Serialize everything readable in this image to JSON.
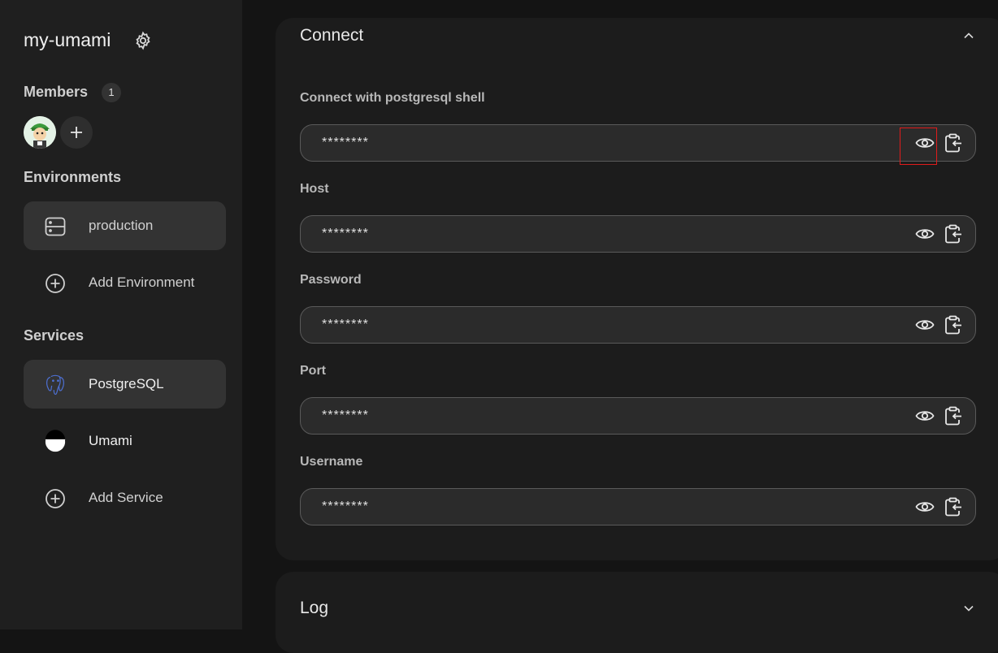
{
  "project": {
    "name": "my-umami"
  },
  "members": {
    "heading": "Members",
    "count": "1"
  },
  "environments": {
    "heading": "Environments",
    "items": [
      {
        "label": "production",
        "icon": "server-icon"
      }
    ],
    "add_label": "Add Environment"
  },
  "services": {
    "heading": "Services",
    "items": [
      {
        "label": "PostgreSQL",
        "icon": "postgresql-icon"
      },
      {
        "label": "Umami",
        "icon": "umami-icon"
      }
    ],
    "add_label": "Add Service"
  },
  "connect": {
    "title": "Connect",
    "fields": [
      {
        "label": "Connect with postgresql shell",
        "value": "********"
      },
      {
        "label": "Host",
        "value": "********"
      },
      {
        "label": "Password",
        "value": "********"
      },
      {
        "label": "Port",
        "value": "********"
      },
      {
        "label": "Username",
        "value": "********"
      }
    ]
  },
  "log": {
    "title": "Log"
  },
  "colors": {
    "background": "#141414",
    "sidebar": "#1f1f1f",
    "card": "#1c1c1c",
    "highlight": "#e01b1b"
  }
}
